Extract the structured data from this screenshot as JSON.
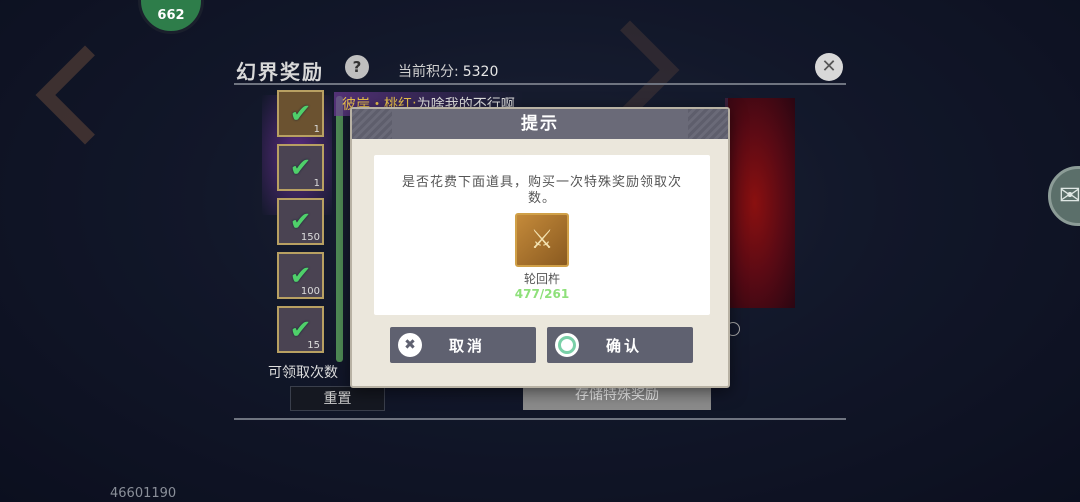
{
  "top_badge": {
    "text": "662"
  },
  "panel": {
    "title": "幻界奖励",
    "help_glyph": "?",
    "points_label": "当前积分:",
    "points_value": "5320",
    "chat_speaker": "彼岸・桃红:",
    "chat_text": "为啥我的不行啊",
    "claim_label": "可领取次数",
    "reset_label": "重置",
    "store_label": "存储特殊奖励",
    "rewards": [
      {
        "qty": "1"
      },
      {
        "qty": "1"
      },
      {
        "qty": "150"
      },
      {
        "qty": "100"
      },
      {
        "qty": "15"
      }
    ]
  },
  "footer": {
    "id_text": "46601190"
  },
  "modal": {
    "title": "提示",
    "message": "是否花费下面道具，购买一次特殊奖励领取次数。",
    "item_name": "轮回杵",
    "item_count": "477/261",
    "cancel_label": "取消",
    "confirm_label": "确认"
  },
  "icons": {
    "check": "check-icon",
    "close": "close-icon",
    "help": "help-icon",
    "wechat": "wechat-icon",
    "item": "pestle-item-icon"
  },
  "colors": {
    "check_green": "#4fd06a",
    "count_green": "#8ee07a",
    "modal_header": "#6a6a78",
    "button": "#5f6170"
  }
}
